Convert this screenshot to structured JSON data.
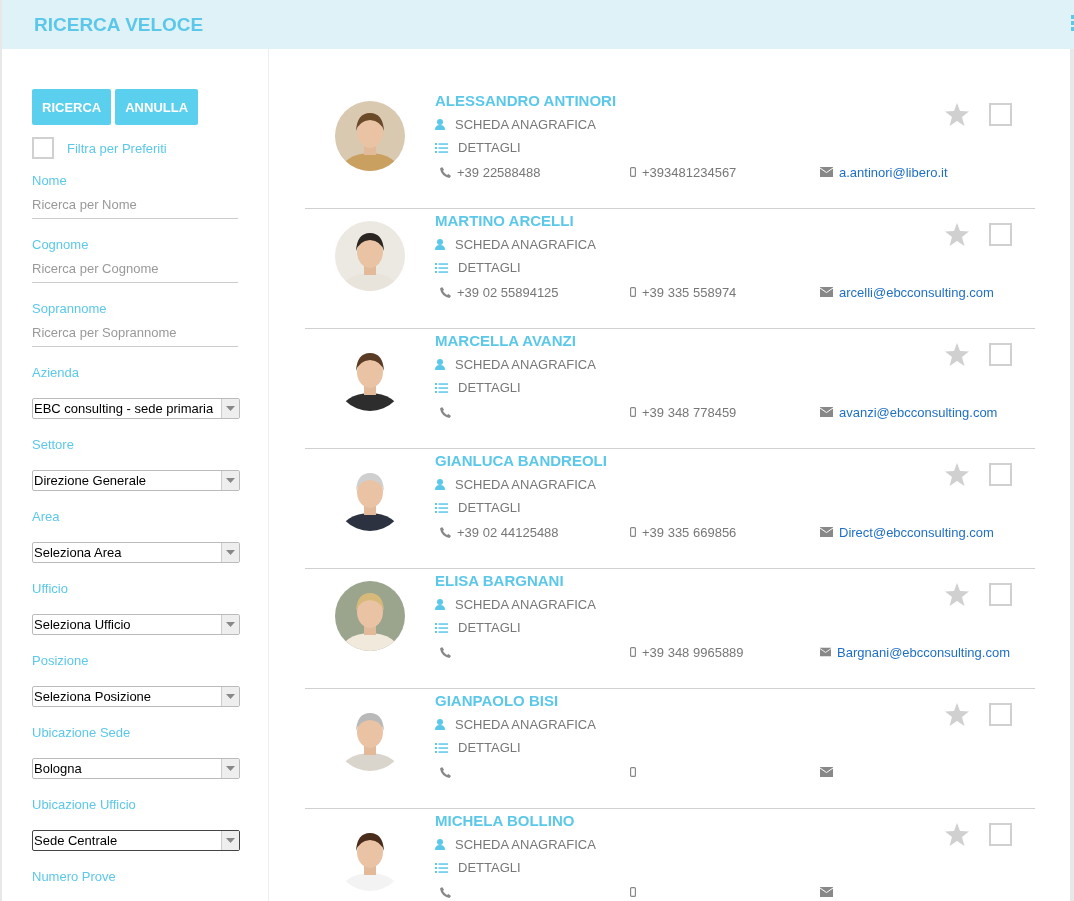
{
  "header": {
    "title": "RICERCA VELOCE"
  },
  "sidebar": {
    "buttons": [
      "RICERCA",
      "ANNULLA"
    ],
    "favorites_filter": {
      "label": "Filtra per Preferiti",
      "checked": false
    },
    "fields": [
      {
        "kind": "text",
        "label": "Nome",
        "placeholder": "Ricerca per Nome"
      },
      {
        "kind": "text",
        "label": "Cognome",
        "placeholder": "Ricerca per Cognome"
      },
      {
        "kind": "text",
        "label": "Soprannome",
        "placeholder": "Ricerca per Soprannome"
      },
      {
        "kind": "select",
        "label": "Azienda",
        "value": "EBC consulting - sede primaria",
        "focused": false
      },
      {
        "kind": "select",
        "label": "Settore",
        "value": "Direzione Generale",
        "focused": false
      },
      {
        "kind": "select",
        "label": "Area",
        "value": "Seleziona Area",
        "focused": false
      },
      {
        "kind": "select",
        "label": "Ufficio",
        "value": "Seleziona Ufficio",
        "focused": false
      },
      {
        "kind": "select",
        "label": "Posizione",
        "value": "Seleziona Posizione",
        "focused": false
      },
      {
        "kind": "select",
        "label": "Ubicazione Sede",
        "value": "Bologna",
        "focused": false
      },
      {
        "kind": "select",
        "label": "Ubicazione Ufficio",
        "value": "Sede Centrale",
        "focused": true
      },
      {
        "kind": "label",
        "label": "Numero Prove"
      }
    ]
  },
  "contacts": [
    {
      "name": "ALESSANDRO ANTINORI",
      "profile_link": "SCHEDA ANAGRAFICA",
      "details_link": "DETTAGLI",
      "phone": "+39 22588488",
      "mobile": "+393481234567",
      "email": "a.antinori@libero.it",
      "favorite": false,
      "checked": false
    },
    {
      "name": "MARTINO ARCELLI",
      "profile_link": "SCHEDA ANAGRAFICA",
      "details_link": "DETTAGLI",
      "phone": "+39 02 55894125",
      "mobile": "+39 335 558974",
      "email": "arcelli@ebcconsulting.com",
      "favorite": false,
      "checked": false
    },
    {
      "name": "MARCELLA AVANZI",
      "profile_link": "SCHEDA ANAGRAFICA",
      "details_link": "DETTAGLI",
      "mobile": "+39 348 778459",
      "email": "avanzi@ebcconsulting.com",
      "favorite": false,
      "checked": false
    },
    {
      "name": "GIANLUCA BANDREOLI",
      "profile_link": "SCHEDA ANAGRAFICA",
      "details_link": "DETTAGLI",
      "phone": "+39 02 44125488",
      "mobile": "+39 335 669856",
      "email": "Direct@ebcconsulting.com",
      "favorite": false,
      "checked": false
    },
    {
      "name": "ELISA BARGNANI",
      "profile_link": "SCHEDA ANAGRAFICA",
      "details_link": "DETTAGLI",
      "mobile": "+39 348 9965889",
      "email": "Bargnani@ebcconsulting.com",
      "favorite": false,
      "checked": false
    },
    {
      "name": "GIANPAOLO BISI",
      "profile_link": "SCHEDA ANAGRAFICA",
      "details_link": "DETTAGLI",
      "favorite": false,
      "checked": false
    },
    {
      "name": "MICHELA BOLLINO",
      "profile_link": "SCHEDA ANAGRAFICA",
      "details_link": "DETTAGLI",
      "favorite": false,
      "checked": false
    }
  ]
}
